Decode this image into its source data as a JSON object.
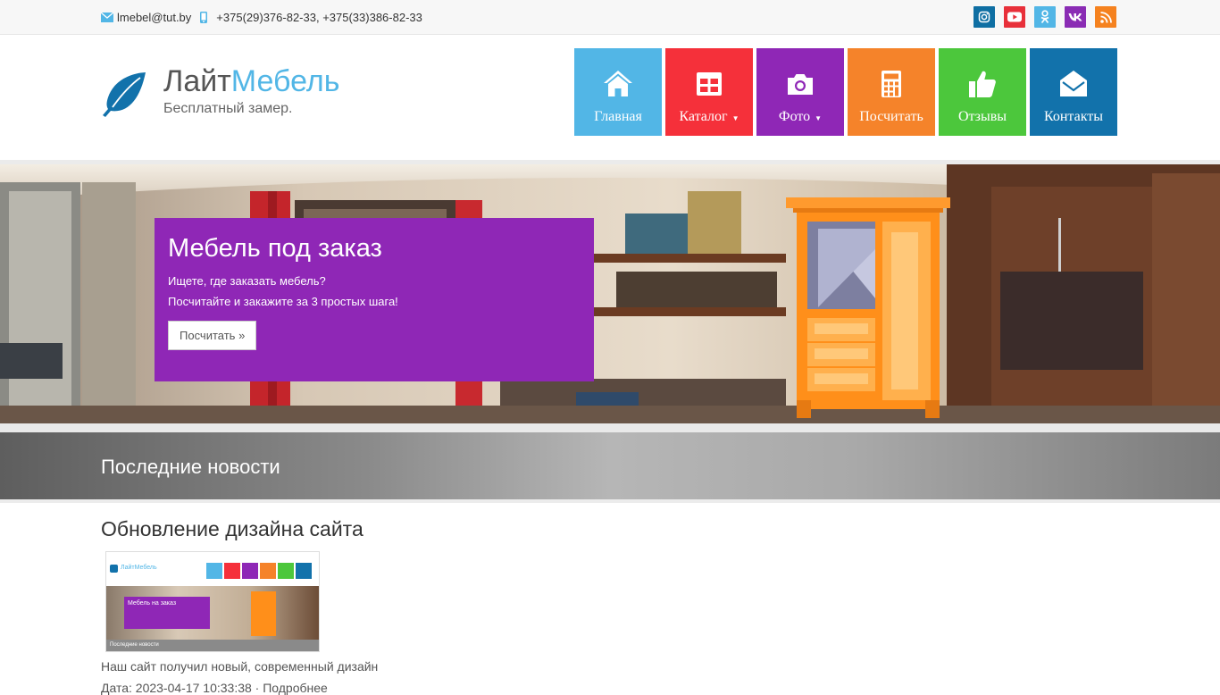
{
  "topbar": {
    "email": "lmebel@tut.by",
    "phones": "+375(29)376-82-33, +375(33)386-82-33",
    "socials": [
      {
        "name": "instagram",
        "color": "#0f6fa3"
      },
      {
        "name": "youtube",
        "color": "#e8303a"
      },
      {
        "name": "odnoklassniki",
        "color": "#52b6e6"
      },
      {
        "name": "vk",
        "color": "#8a2cb4"
      },
      {
        "name": "rss",
        "color": "#f5821f"
      }
    ]
  },
  "logo": {
    "brand_part1": "Лайт",
    "brand_part2": "Мебель",
    "tagline": "Бесплатный замер."
  },
  "nav": {
    "items": [
      {
        "label": "Главная",
        "icon": "home-icon",
        "color": "#52b6e6"
      },
      {
        "label": "Каталог",
        "icon": "grid-icon",
        "color": "#f5303a",
        "dropdown": true
      },
      {
        "label": "Фото",
        "icon": "camera-icon",
        "color": "#8f27b6",
        "dropdown": true
      },
      {
        "label": "Посчитать",
        "icon": "calculator-icon",
        "color": "#f5832a"
      },
      {
        "label": "Отзывы",
        "icon": "thumbs-up-icon",
        "color": "#4cc73c"
      },
      {
        "label": "Контакты",
        "icon": "envelope-open-icon",
        "color": "#1272ab"
      }
    ],
    "caret": "▼"
  },
  "hero": {
    "title": "Мебель под заказ",
    "line1": "Ищете, где заказать мебель?",
    "line2": "Посчитайте и закажите за 3 простых шага!",
    "button_label": "Посчитать"
  },
  "news_band": {
    "title": "Последние новости"
  },
  "news": {
    "title": "Обновление дизайна сайта",
    "description": "Наш сайт получил новый, современный дизайн",
    "meta": "Дата: 2023-04-17 10:33:38 · Подробнее"
  },
  "thumbnail": {
    "brand": "ЛайтМебель",
    "promo": "Мебель на заказ",
    "footer": "Последние новости"
  }
}
